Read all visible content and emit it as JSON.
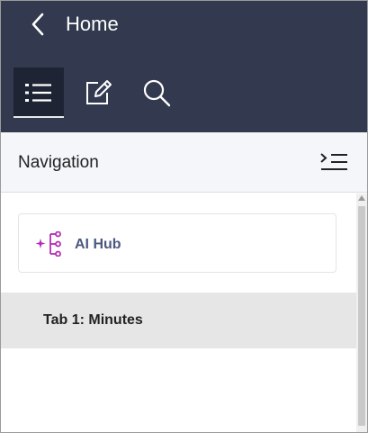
{
  "header": {
    "title": "Home",
    "back_icon": "chevron-left-icon",
    "toolbar": [
      {
        "name": "outline",
        "icon": "list-icon",
        "active": true
      },
      {
        "name": "edit",
        "icon": "edit-icon",
        "active": false
      },
      {
        "name": "search",
        "icon": "search-icon",
        "active": false
      }
    ],
    "bg_color": "#333a4f"
  },
  "navigation": {
    "title": "Navigation",
    "collapse_icon": "collapse-menu-icon"
  },
  "content": {
    "ai_hub": {
      "label": "AI Hub",
      "icon": "ai-hub-icon",
      "accent": "#b52bb5"
    },
    "tabs": [
      {
        "label": "Tab 1: Minutes",
        "selected": true
      }
    ]
  }
}
